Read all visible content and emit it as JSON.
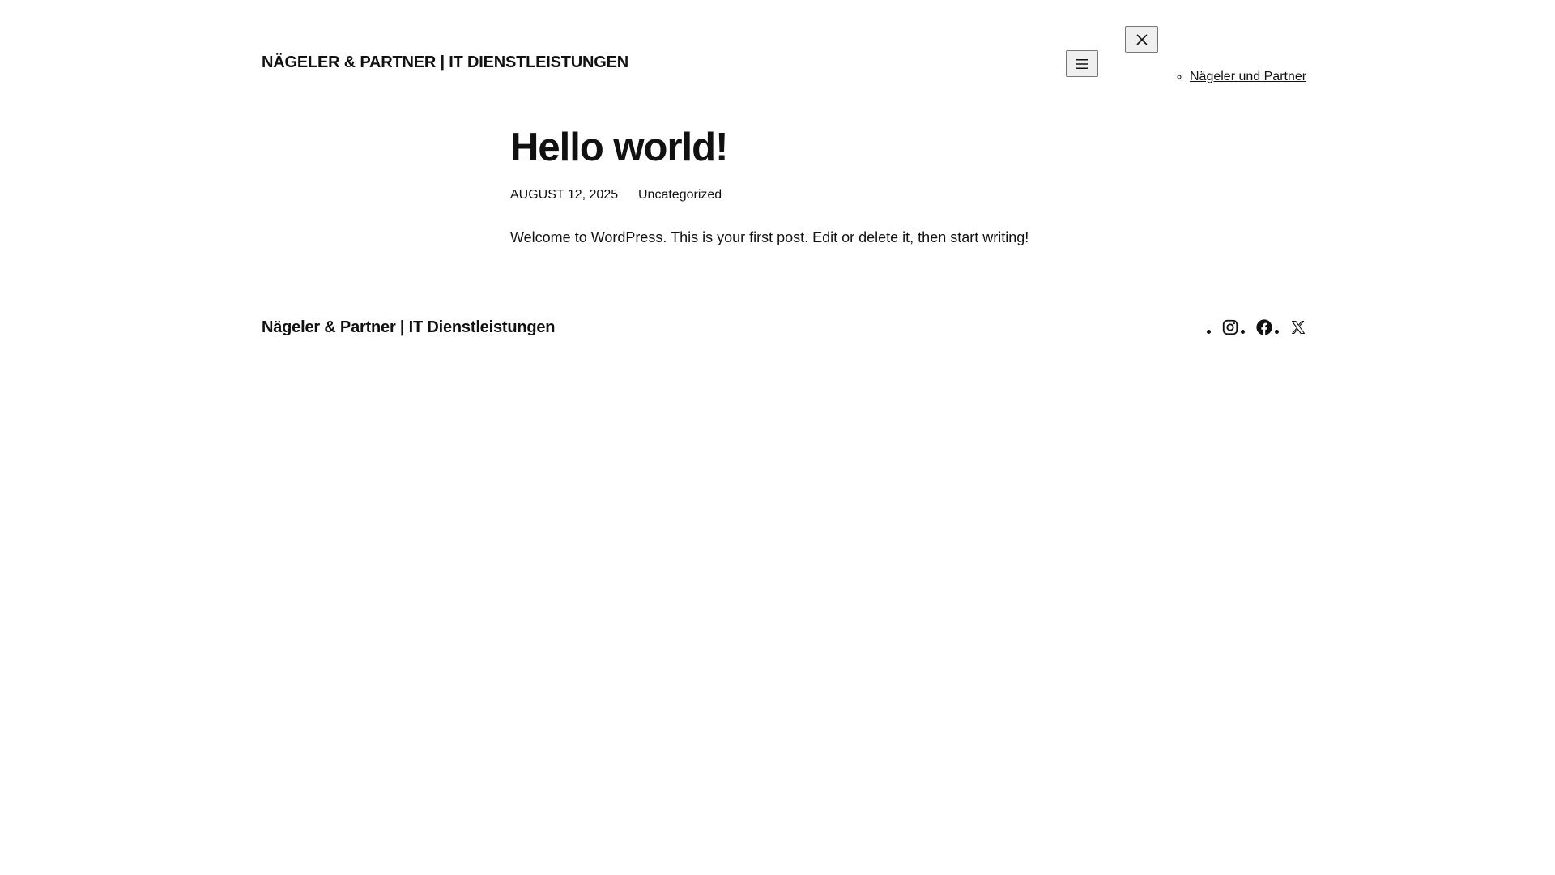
{
  "header": {
    "site_title": "NÄGELER & PARTNER | IT DIENSTLEISTUNGEN",
    "open_menu_icon": "hamburger-icon",
    "close_menu_icon": "close-icon",
    "nav_items": [
      {
        "label": "Nägeler und Partner"
      }
    ]
  },
  "post": {
    "title": "Hello world!",
    "date": "AUGUST 12, 2025",
    "category": "Uncategorized",
    "content": "Welcome to WordPress. This is your first post. Edit or delete it, then start writing!"
  },
  "footer": {
    "site_title": "Nägeler & Partner | IT Dienstleistungen",
    "social_links": [
      {
        "icon": "instagram-icon"
      },
      {
        "icon": "facebook-icon"
      },
      {
        "icon": "x-icon"
      }
    ]
  },
  "colors": {
    "text": "#111111",
    "background": "#ffffff",
    "button_background": "#efefef",
    "button_border": "#767676"
  }
}
